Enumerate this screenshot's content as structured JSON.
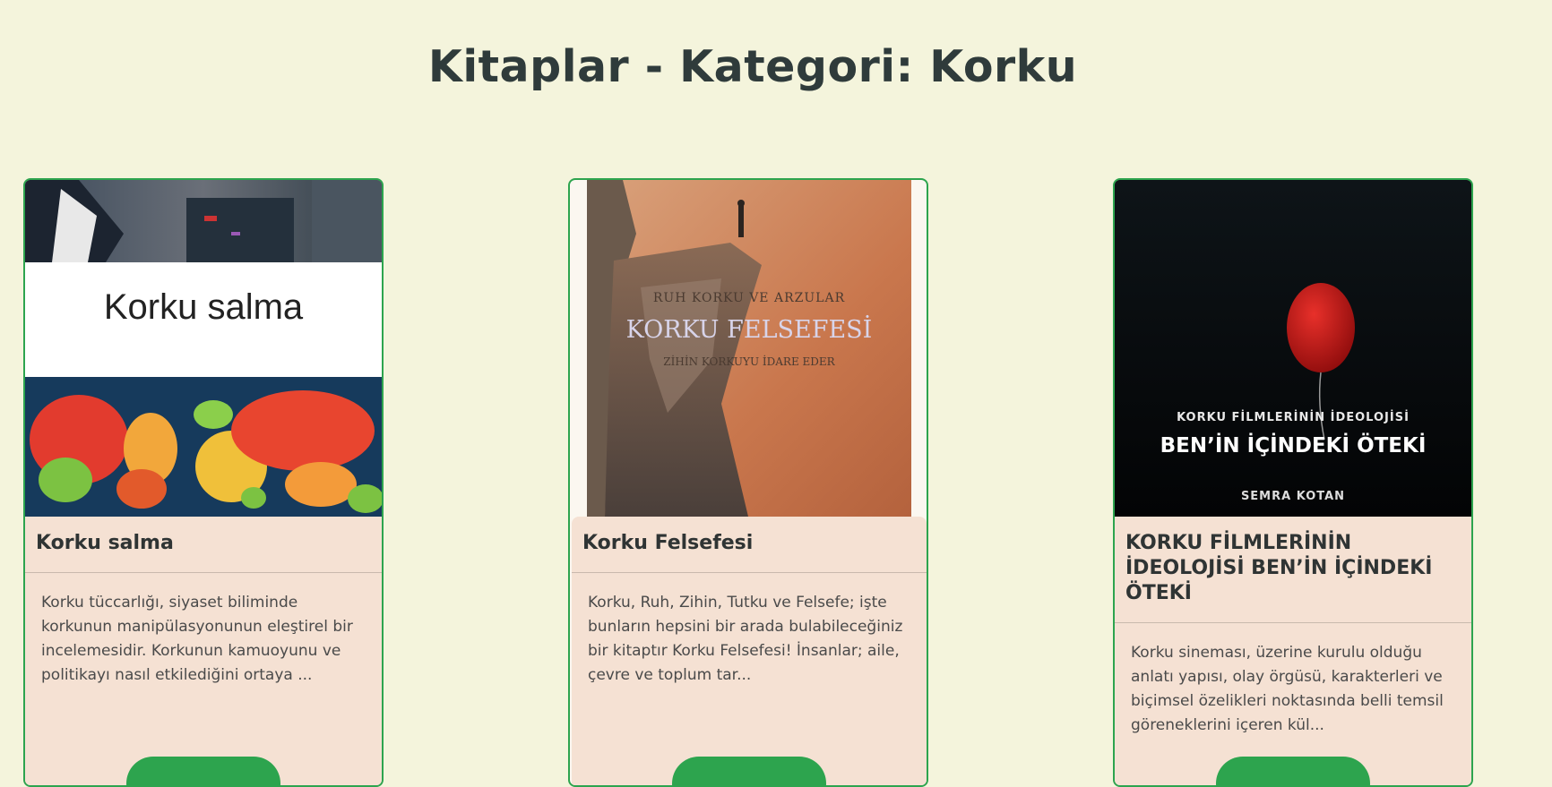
{
  "page": {
    "title": "Kitaplar - Kategori: Korku"
  },
  "books": [
    {
      "cover_text": "Korku salma",
      "title": "Korku salma",
      "description": "Korku tüccarlığı, siyaset biliminde korkunun manipülasyonunun eleştirel bir incelemesidir. Korkunun kamuoyunu ve politikayı nasıl etkilediğini ortaya ...",
      "button_label": ""
    },
    {
      "cover_text": {
        "top": "RUH KORKU VE ARZULAR",
        "main": "KORKU FELSEFESİ",
        "sub": "ZİHİN KORKUYU İDARE EDER"
      },
      "title": "Korku Felsefesi",
      "description": "Korku, Ruh, Zihin, Tutku ve Felsefe; işte bunların hepsini bir arada bulabileceğiniz bir kitaptır Korku Felsefesi! İnsanlar; aile, çevre ve toplum tar...",
      "button_label": ""
    },
    {
      "cover_text": {
        "top": "KORKU FİLMLERİNİN İDEOLOJİSİ",
        "main": "BEN’İN İÇİNDEKİ ÖTEKİ",
        "author": "SEMRA KOTAN"
      },
      "title": "KORKU FİLMLERİNİN İDEOLOJİSİ BEN’İN İÇİNDEKİ ÖTEKİ",
      "description": "Korku sineması, üzerine kurulu olduğu anlatı yapısı, olay örgüsü, karakterleri ve biçimsel özelikleri noktasında belli temsil göreneklerini içeren kül...",
      "button_label": ""
    }
  ],
  "colors": {
    "background": "#f4f4dc",
    "accent": "#2da44e",
    "card": "#f5e1d3"
  }
}
